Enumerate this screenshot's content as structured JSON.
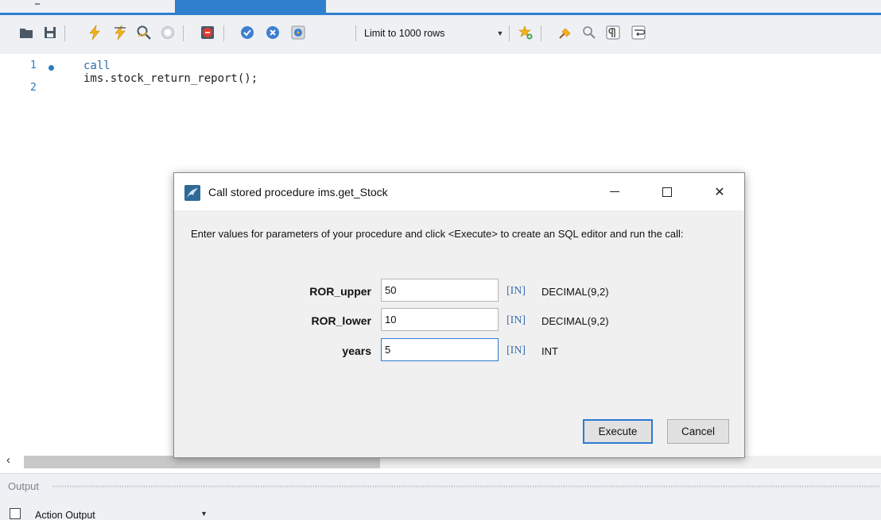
{
  "toolbar": {
    "limit_label": "Limit to 1000 rows"
  },
  "editor": {
    "lines": [
      {
        "number": "1",
        "code_keyword": "call",
        "code_rest": " ims.stock_return_report();"
      },
      {
        "number": "2",
        "code_keyword": "",
        "code_rest": ""
      }
    ]
  },
  "output": {
    "title": "Output",
    "selector": "Action Output"
  },
  "dialog": {
    "title": "Call stored procedure ims.get_Stock",
    "description": "Enter values for parameters of your procedure and click <Execute> to create an SQL editor and run the call:",
    "params": [
      {
        "name": "ROR_upper",
        "value": "50",
        "direction": "[IN]",
        "type": "DECIMAL(9,2)"
      },
      {
        "name": "ROR_lower",
        "value": "10",
        "direction": "[IN]",
        "type": "DECIMAL(9,2)"
      },
      {
        "name": "years",
        "value": "5",
        "direction": "[IN]",
        "type": "INT"
      }
    ],
    "execute_label": "Execute",
    "cancel_label": "Cancel"
  },
  "colors": {
    "accent": "#2f7fcf",
    "gutter": "#2b7bbd",
    "param_direction": "#3b6fb0"
  }
}
